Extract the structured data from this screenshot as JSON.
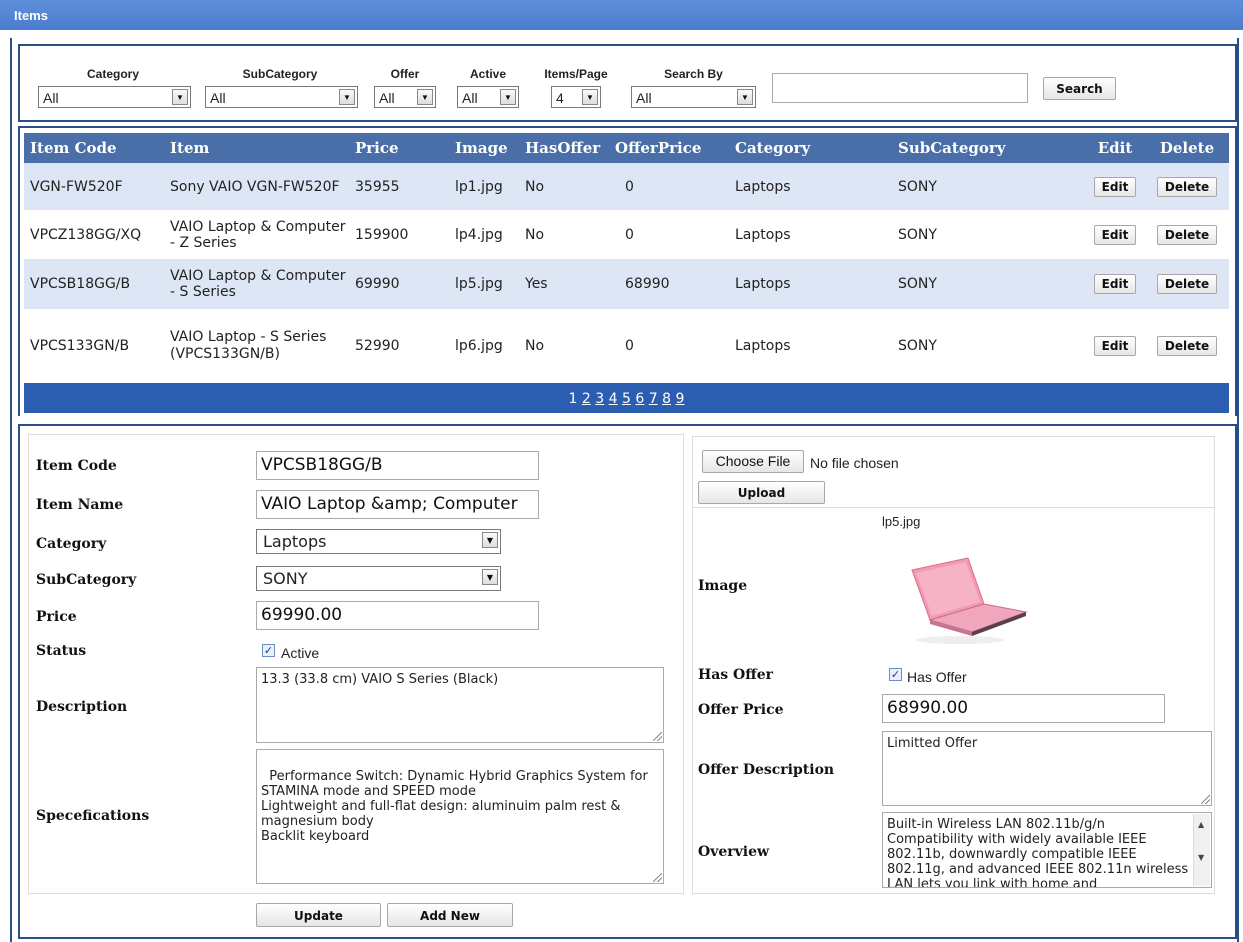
{
  "window": {
    "title": "Items"
  },
  "filters": {
    "category": {
      "label": "Category",
      "value": "All"
    },
    "subcategory": {
      "label": "SubCategory",
      "value": "All"
    },
    "offer": {
      "label": "Offer",
      "value": "All"
    },
    "active": {
      "label": "Active",
      "value": "All"
    },
    "items_per_page": {
      "label": "Items/Page",
      "value": "4"
    },
    "search_by": {
      "label": "Search By",
      "value": "All"
    },
    "search_text": "",
    "search_button": "Search"
  },
  "grid": {
    "columns": [
      "Item Code",
      "Item",
      "Price",
      "Image",
      "HasOffer",
      "OfferPrice",
      "Category",
      "SubCategory",
      "Edit",
      "Delete"
    ],
    "edit_label": "Edit",
    "delete_label": "Delete",
    "rows": [
      {
        "code": "VGN-FW520F",
        "item": "Sony VAIO VGN-FW520F",
        "price": "35955",
        "image": "lp1.jpg",
        "has_offer": "No",
        "offer_price": "0",
        "category": "Laptops",
        "subcategory": "SONY"
      },
      {
        "code": "VPCZ138GG/XQ",
        "item": "VAIO Laptop & Computer - Z Series",
        "price": "159900",
        "image": "lp4.jpg",
        "has_offer": "No",
        "offer_price": "0",
        "category": "Laptops",
        "subcategory": "SONY"
      },
      {
        "code": "VPCSB18GG/B",
        "item": "VAIO Laptop & Computer - S Series",
        "price": "69990",
        "image": "lp5.jpg",
        "has_offer": "Yes",
        "offer_price": "68990",
        "category": "Laptops",
        "subcategory": "SONY"
      },
      {
        "code": "VPCS133GN/B",
        "item": "VAIO Laptop - S Series (VPCS133GN/B)",
        "price": "52990",
        "image": "lp6.jpg",
        "has_offer": "No",
        "offer_price": "0",
        "category": "Laptops",
        "subcategory": "SONY"
      }
    ],
    "pager": {
      "current": "1",
      "pages": [
        "2",
        "3",
        "4",
        "5",
        "6",
        "7",
        "8",
        "9"
      ]
    }
  },
  "form": {
    "item_code": {
      "label": "Item Code",
      "value": "VPCSB18GG/B"
    },
    "item_name": {
      "label": "Item Name",
      "value": "VAIO Laptop &amp; Computer"
    },
    "category": {
      "label": "Category",
      "value": "Laptops"
    },
    "subcategory": {
      "label": "SubCategory",
      "value": "SONY"
    },
    "price": {
      "label": "Price",
      "value": "69990.00"
    },
    "status": {
      "label": "Status",
      "checkbox_label": "Active",
      "checked": true
    },
    "description": {
      "label": "Description",
      "value": "13.3 (33.8 cm) VAIO S Series (Black)"
    },
    "specifications": {
      "label": "Specefications",
      "value": "Performance Switch: Dynamic Hybrid Graphics System for STAMINA mode and SPEED mode\nLightweight and full-flat design: aluminuim palm rest & magnesium body\nBacklit keyboard"
    },
    "update_button": "Update",
    "add_new_button": "Add New",
    "file": {
      "choose_label": "Choose File",
      "status": "No file chosen",
      "upload_label": "Upload"
    },
    "image": {
      "label": "Image",
      "filename": "lp5.jpg"
    },
    "has_offer": {
      "label": "Has Offer",
      "checkbox_label": "Has Offer",
      "checked": true
    },
    "offer_price": {
      "label": "Offer Price",
      "value": "68990.00"
    },
    "offer_description": {
      "label": "Offer Description",
      "value": "Limitted Offer"
    },
    "overview": {
      "label": "Overview",
      "value": "Built-in Wireless LAN 802.11b/g/n Compatibility with widely available IEEE 802.11b, downwardly compatible IEEE 802.11g, and advanced IEEE 802.11n wireless LAN lets you link with home and"
    }
  },
  "colors": {
    "header_bar": "#4a7ccf",
    "grid_header": "#4a6fa8",
    "row_alt": "#dde6f4",
    "pager": "#2b5eb1",
    "border": "#2a4f86"
  }
}
